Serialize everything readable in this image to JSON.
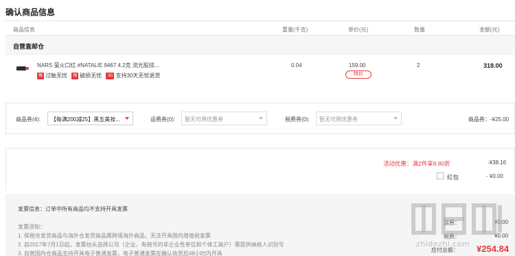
{
  "page": {
    "title": "确认商品信息"
  },
  "table_header": {
    "product": "商品信息",
    "weight": "重量(千克)",
    "price": "单价(元)",
    "quantity": "数量",
    "amount": "金额(元)"
  },
  "store": {
    "name": "自营直邮仓"
  },
  "product": {
    "name": "NARS 萤火口红 #NATALIE 9467 4.2克 流光股炫...",
    "weight": "0.04",
    "price": "159.00",
    "price_tag": "特价",
    "quantity": "2",
    "amount": "318.00",
    "tags": [
      {
        "badge": "保",
        "text": "过敏无忧"
      },
      {
        "badge": "保",
        "text": "破损无忧"
      },
      {
        "badge": "30",
        "text": "支持30天无忧退货"
      }
    ]
  },
  "coupons": {
    "product_coupon_label": "商品券(4):",
    "product_coupon_value": "【每满200减25】黑五美妆...",
    "shipping_coupon_label": "运费券(0):",
    "shipping_coupon_value": "暂无可用优惠券",
    "tax_coupon_label": "税费券(0):",
    "tax_coupon_value": "暂无可用优惠券",
    "summary": "商品券：-¥25.00"
  },
  "discounts": {
    "activity_label": "活动优惠：满2件享8.80折",
    "activity_value": "-¥38.16",
    "redpack_label": "红包",
    "redpack_value": "- ¥0.00"
  },
  "invoice": {
    "info": "发票信息：订单中所有商品均不支持开具发票",
    "notice_title": "发票须知：",
    "notices": [
      "1. 保税仓发货商品与海外仓发货商品属跨境海外商品，无法开具国内增值税发票",
      "2. 自2017年7月1日起，发票抬头选择公司（企业、有税号的非企业性单位和个体工商户）需提供纳税人识别号",
      "3. 自营国内仓商品支持开具电子普通发票，电子普通发票在确认收货后48小时内开具"
    ]
  },
  "summary": {
    "rows": [
      {
        "label": "运费：",
        "value": "¥0.00"
      },
      {
        "label": "税费：",
        "value": "¥0.00"
      }
    ],
    "pay_label": "应付总额：",
    "pay_value": "¥254.84"
  },
  "watermark": {
    "text": "zhidezhi.com"
  },
  "colors": {
    "accent": "#e4393c",
    "panel_bg": "#f5f5f5",
    "border": "#e6e6e6"
  }
}
